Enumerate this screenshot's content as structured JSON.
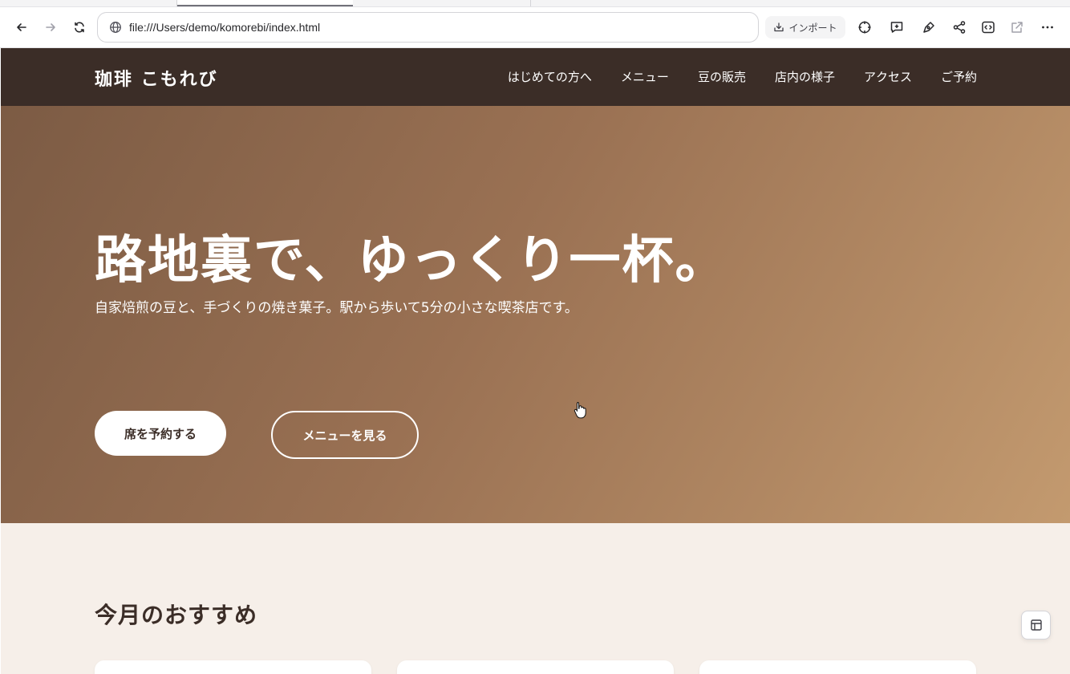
{
  "browser": {
    "url": "file:///Users/demo/komorebi/index.html",
    "import_label": "インポート",
    "icons": {
      "back": "arrow-left-icon",
      "forward": "arrow-right-icon",
      "reload": "reload-icon",
      "site": "globe-icon",
      "import": "download-box-icon",
      "target": "crosshair-icon",
      "comment": "comment-plus-icon",
      "annotate": "pen-tool-icon",
      "share": "share-icon",
      "code": "code-icon",
      "open_external": "external-link-icon",
      "more": "more-horizontal-icon"
    }
  },
  "site": {
    "logo": "珈琲 こもれび",
    "nav": [
      "はじめての方へ",
      "メニュー",
      "豆の販売",
      "店内の様子",
      "アクセス",
      "ご予約"
    ],
    "colors": {
      "header_bg": "#3b2d27",
      "hero_from": "#7c5b44",
      "hero_to": "#c39a6f",
      "section_bg": "#f6efe9"
    }
  },
  "hero": {
    "title": "路地裏で、ゆっくり一杯。",
    "subtitle": "自家焙煎の豆と、手づくりの焼き菓子。駅から歩いて5分の小さな喫茶店です。",
    "primary_cta": "席を予約する",
    "secondary_cta": "メニューを見る"
  },
  "recommend": {
    "title": "今月のおすすめ"
  },
  "overlay": {
    "layout_icon": "layout-panel-icon"
  }
}
